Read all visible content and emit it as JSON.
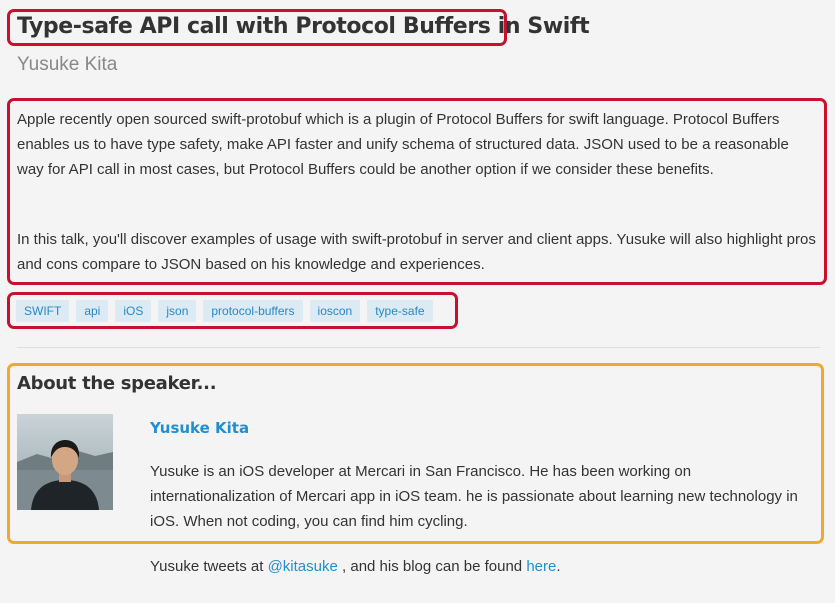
{
  "talk": {
    "title": "Type-safe API call with Protocol Buffers in Swift",
    "speaker": "Yusuke Kita",
    "abstract_p1": "Apple recently open sourced swift-protobuf which is a plugin of Protocol Buffers for swift language. Protocol Buffers enables us to have type safety, make API faster and unify schema of structured data. JSON used to be a reasonable way for API call in most cases, but Protocol Buffers could be another option if we consider these benefits.",
    "abstract_p2": "In this talk, you'll discover examples of usage with swift-protobuf in server and client apps. Yusuke will also highlight pros and cons compare to JSON based on his knowledge and experiences."
  },
  "tags": [
    "SWIFT",
    "api",
    "iOS",
    "json",
    "protocol-buffers",
    "ioscon",
    "type-safe"
  ],
  "about": {
    "heading": "About the speaker...",
    "name": "Yusuke Kita",
    "bio": "Yusuke is an iOS developer at Mercari in San Francisco. He has been working on internationalization of Mercari app in iOS team. he is passionate about learning new technology in iOS. When not coding, you can find him cycling.",
    "tweets_prefix": "Yusuke tweets at ",
    "twitter_handle": "@kitasuke",
    "tweets_middle": " , and his blog can be found ",
    "blog_link": "here",
    "tweets_suffix": "."
  },
  "colors": {
    "title_border": "#c8102e",
    "about_border": "#f0a830",
    "link": "#1f8fcf",
    "tag_bg": "#dbeaf3"
  }
}
